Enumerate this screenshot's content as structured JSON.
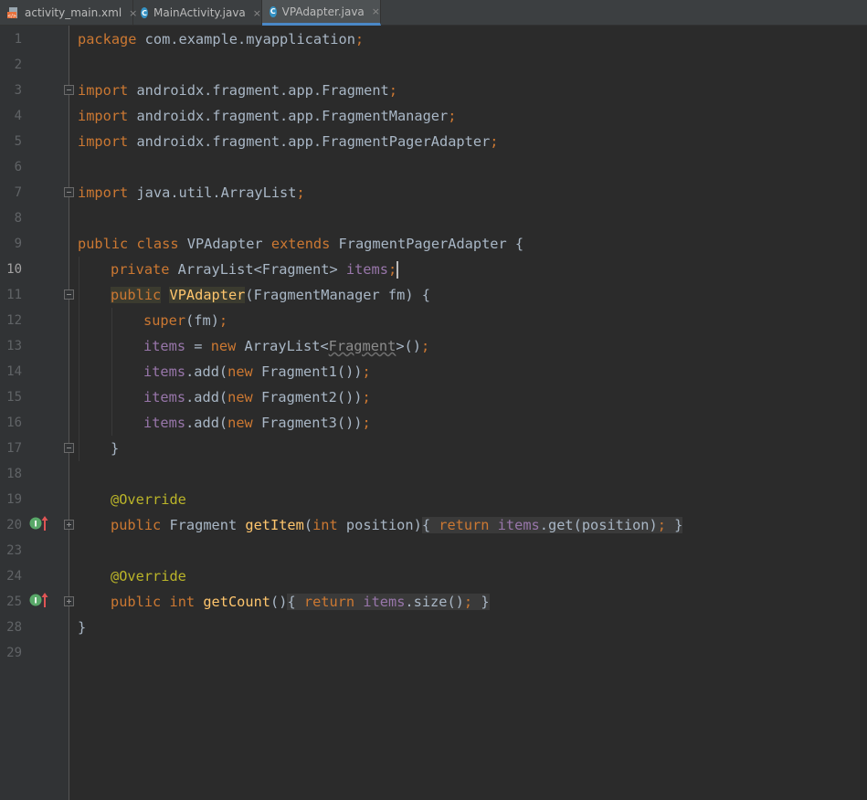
{
  "tabs": [
    {
      "label": "activity_main.xml",
      "icon": "xml-file-icon",
      "close": "×"
    },
    {
      "label": "MainActivity.java",
      "icon": "java-class-icon",
      "close": "×"
    },
    {
      "label": "VPAdapter.java",
      "icon": "java-class-icon",
      "close": "×",
      "active": true
    }
  ],
  "class_icon_letter": "C",
  "gutter_icon_letter": "I",
  "line_numbers": [
    "1",
    "2",
    "3",
    "4",
    "5",
    "6",
    "7",
    "8",
    "9",
    "10",
    "11",
    "12",
    "13",
    "14",
    "15",
    "16",
    "17",
    "18",
    "19",
    "20",
    "23",
    "24",
    "25",
    "28",
    "29"
  ],
  "current_line": "10",
  "code": {
    "l1": {
      "kw": "package",
      "rest": " com.example.myapplication",
      "semi": ";"
    },
    "l3": {
      "kw": "import",
      "rest": " androidx.fragment.app.Fragment",
      "semi": ";"
    },
    "l4": {
      "kw": "import",
      "rest": " androidx.fragment.app.FragmentManager",
      "semi": ";"
    },
    "l5": {
      "kw": "import",
      "rest": " androidx.fragment.app.FragmentPagerAdapter",
      "semi": ";"
    },
    "l7": {
      "kw": "import",
      "rest": " java.util.ArrayList",
      "semi": ";"
    },
    "l9": {
      "kw1": "public",
      "kw2": "class",
      "name": " VPAdapter ",
      "kw3": "extends",
      "rest": " FragmentPagerAdapter {"
    },
    "l10": {
      "kw": "private",
      "type": " ArrayList<Fragment> ",
      "field": "items",
      "semi": ";"
    },
    "l11": {
      "kw": "public",
      "fn": "VPAdapter",
      "rest": "(FragmentManager fm) {"
    },
    "l12": {
      "kw": "super",
      "rest": "(fm)",
      "semi": ";"
    },
    "l13": {
      "field": "items",
      "eq": " = ",
      "kw": "new",
      "t1": " ArrayList<",
      "sq": "Fragment",
      "t2": ">()",
      "semi": ";"
    },
    "l14": {
      "field": "items",
      "m": ".add(",
      "kw": "new",
      "rest": " Fragment1())",
      "semi": ";"
    },
    "l15": {
      "field": "items",
      "m": ".add(",
      "kw": "new",
      "rest": " Fragment2())",
      "semi": ";"
    },
    "l16": {
      "field": "items",
      "m": ".add(",
      "kw": "new",
      "rest": " Fragment3())",
      "semi": ";"
    },
    "l17": {
      "rest": "}"
    },
    "l19": {
      "ann": "@Override"
    },
    "l20": {
      "kw": "public",
      "type": " Fragment ",
      "fn": "getItem",
      "p1": "(",
      "kw2": "int",
      "p2": " position)",
      "ob": "{ ",
      "kw3": "return",
      "sp": " ",
      "field": "items",
      "rest": ".get(position)",
      "semi": ";",
      "cb": " }"
    },
    "l24": {
      "ann": "@Override"
    },
    "l25": {
      "kw": "public",
      "sp1": " ",
      "kw2": "int",
      "sp2": " ",
      "fn": "getCount",
      "p": "()",
      "ob": "{ ",
      "kw3": "return",
      "sp": " ",
      "field": "items",
      "rest": ".size()",
      "semi": ";",
      "cb": " }"
    },
    "l28": {
      "rest": "}"
    }
  },
  "colors": {
    "background": "#2b2b2b",
    "gutter": "#313335",
    "keyword": "#cc7832",
    "field": "#9876aa",
    "function": "#ffc66d",
    "annotation": "#bbb529",
    "text": "#a9b7c6",
    "active_tab_underline": "#4a88c7"
  }
}
